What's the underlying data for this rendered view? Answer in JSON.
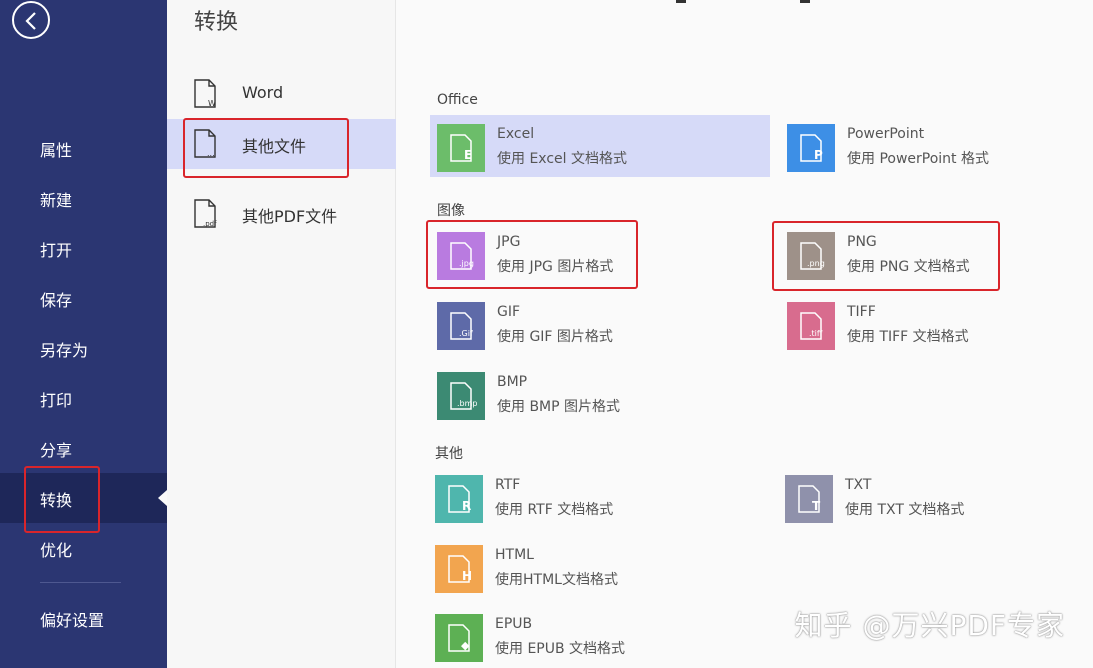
{
  "sidebar": {
    "items": [
      {
        "label": "属性"
      },
      {
        "label": "新建"
      },
      {
        "label": "打开"
      },
      {
        "label": "保存"
      },
      {
        "label": "另存为"
      },
      {
        "label": "打印"
      },
      {
        "label": "分享"
      },
      {
        "label": "转换"
      },
      {
        "label": "优化"
      },
      {
        "label": "偏好设置"
      }
    ],
    "active": "转换"
  },
  "midpanel": {
    "title": "转换",
    "items": [
      {
        "label": "Word",
        "icon_text": "W"
      },
      {
        "label": "其他文件",
        "icon_text": "..."
      },
      {
        "label": "其他PDF文件",
        "icon_text": ".pdf"
      }
    ],
    "active": "其他文件"
  },
  "content": {
    "sections": [
      {
        "title": "Office"
      },
      {
        "title": "图像"
      },
      {
        "title": "其他"
      }
    ],
    "formats": [
      {
        "name": "Excel",
        "desc": "使用 Excel 文档格式",
        "icon_text": "E",
        "color": "#6cbd6a"
      },
      {
        "name": "PowerPoint",
        "desc": "使用 PowerPoint 格式",
        "icon_text": "P",
        "color": "#3d8fe6"
      },
      {
        "name": "JPG",
        "desc": "使用 JPG 图片格式",
        "icon_text": ".jpg",
        "color": "#b97be0"
      },
      {
        "name": "PNG",
        "desc": "使用 PNG 文档格式",
        "icon_text": ".png",
        "color": "#9e9189"
      },
      {
        "name": "GIF",
        "desc": "使用 GIF 图片格式",
        "icon_text": ".Gif",
        "color": "#5e6aa8"
      },
      {
        "name": "TIFF",
        "desc": "使用 TIFF 文档格式",
        "icon_text": ".tiff",
        "color": "#d86c8e"
      },
      {
        "name": "BMP",
        "desc": "使用 BMP 图片格式",
        "icon_text": ".bmp",
        "color": "#3c8a73"
      },
      {
        "name": "RTF",
        "desc": "使用 RTF 文档格式",
        "icon_text": "R",
        "color": "#4fb6ad"
      },
      {
        "name": "TXT",
        "desc": "使用 TXT 文档格式",
        "icon_text": "T",
        "color": "#8f91ab"
      },
      {
        "name": "HTML",
        "desc": "使用HTML文档格式",
        "icon_text": "H",
        "color": "#f2a54f"
      },
      {
        "name": "EPUB",
        "desc": "使用 EPUB 文档格式",
        "icon_text": "◆",
        "color": "#5db054"
      }
    ],
    "active_format": "Excel"
  },
  "watermark": "知乎 @万兴PDF专家",
  "colors": {
    "sidebar_bg": "#2b3672",
    "sidebar_active": "#1e2759",
    "selection_bg": "#d6daf8",
    "highlight_red": "#d9252b"
  }
}
